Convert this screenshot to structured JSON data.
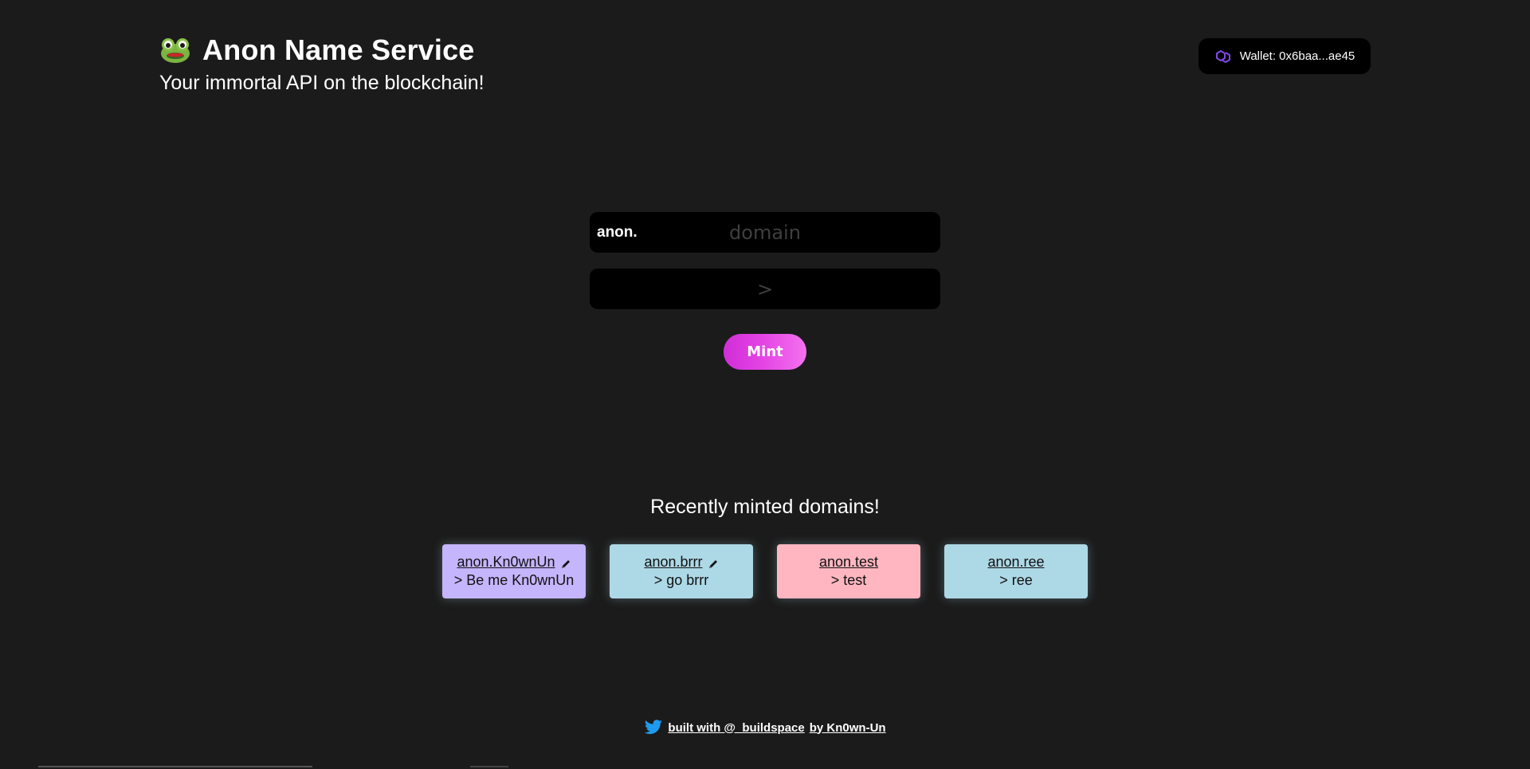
{
  "header": {
    "title": "Anon Name Service",
    "subtitle": "Your immortal API on the blockchain!"
  },
  "wallet": {
    "label": "Wallet: 0x6baa...ae45",
    "icon": "polygon-icon"
  },
  "form": {
    "tld_prefix": "anon.",
    "domain_placeholder": "domain",
    "domain_value": "",
    "record_placeholder": ">",
    "record_value": "",
    "mint_label": "Mint"
  },
  "recent": {
    "title": "Recently minted domains!",
    "cards": [
      {
        "name": "anon.Kn0wnUn",
        "record": "> Be me Kn0wnUn",
        "editable": true,
        "color": "#c4b5fd"
      },
      {
        "name": "anon.brrr",
        "record": "> go brrr",
        "editable": true,
        "color": "#add8e6"
      },
      {
        "name": "anon.test",
        "record": "> test",
        "editable": false,
        "color": "#ffb6c1"
      },
      {
        "name": "anon.ree",
        "record": "> ree",
        "editable": false,
        "color": "#add8e6"
      }
    ]
  },
  "footer": {
    "built_with": "built with @_buildspace",
    "by": "by Kn0wn-Un",
    "icon": "twitter-icon"
  },
  "colors": {
    "background": "#1b1b1b",
    "mint_gradient_start": "#d12fd7",
    "mint_gradient_end": "#f472ef",
    "twitter_blue": "#1d9bf0",
    "polygon_purple": "#8247e5"
  }
}
